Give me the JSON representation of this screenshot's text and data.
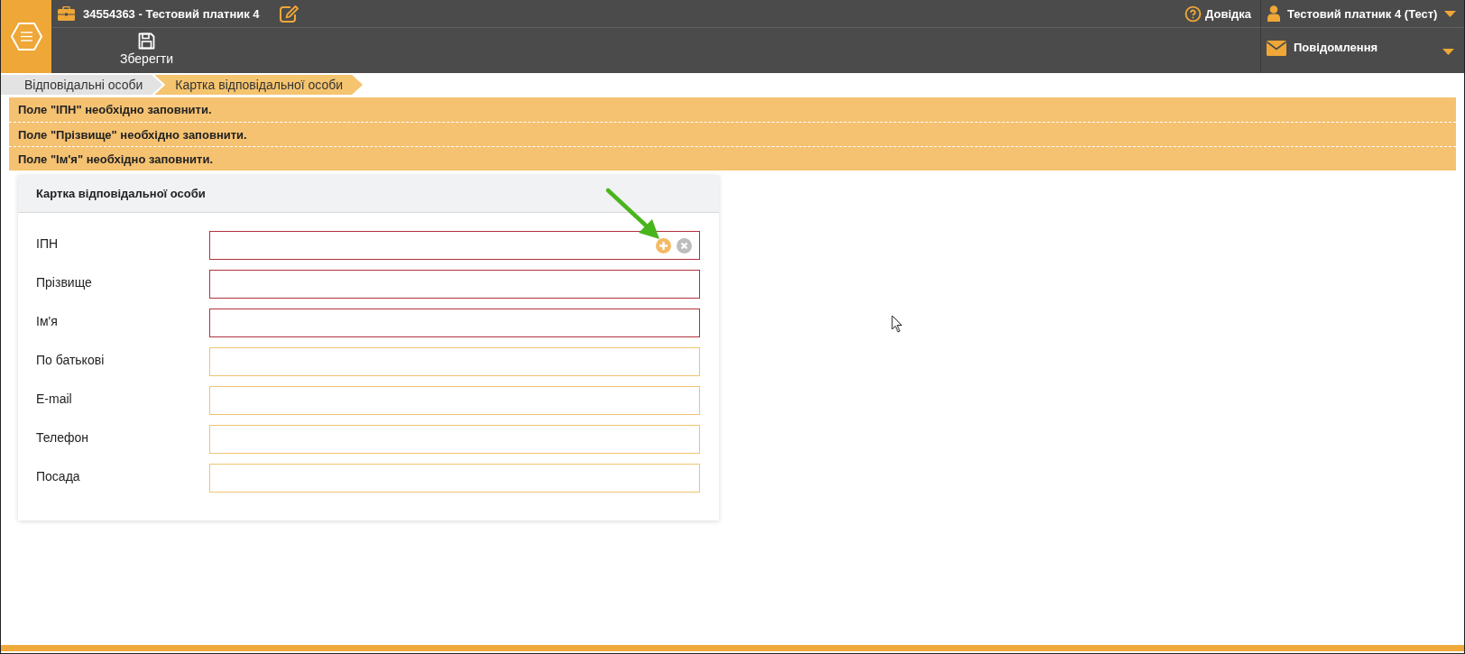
{
  "header": {
    "account": "34554363 - Тестовий платник 4",
    "help": "Довідка",
    "user": "Тестовий платник 4 (Тест)",
    "save_button": "Зберегти",
    "messages": "Повідомлення"
  },
  "breadcrumbs": [
    {
      "label": "Відповідальні особи",
      "selected": false
    },
    {
      "label": "Картка відповідальної особи",
      "selected": true
    }
  ],
  "alerts": [
    "Поле \"ІПН\" необхідно заповнити.",
    "Поле \"Прізвище\" необхідно заповнити.",
    "Поле \"Ім'я\" необхідно заповнити."
  ],
  "card": {
    "title": "Картка відповідальної особи",
    "fields": [
      {
        "label": "ІПН",
        "invalid": true,
        "actions": true
      },
      {
        "label": "Прізвище",
        "invalid": true,
        "actions": false
      },
      {
        "label": "Ім'я",
        "invalid": true,
        "actions": false
      },
      {
        "label": "По батькові",
        "invalid": false,
        "actions": false
      },
      {
        "label": "E-mail",
        "invalid": false,
        "actions": false
      },
      {
        "label": "Телефон",
        "invalid": false,
        "actions": false
      },
      {
        "label": "Посада",
        "invalid": false,
        "actions": false
      }
    ]
  }
}
